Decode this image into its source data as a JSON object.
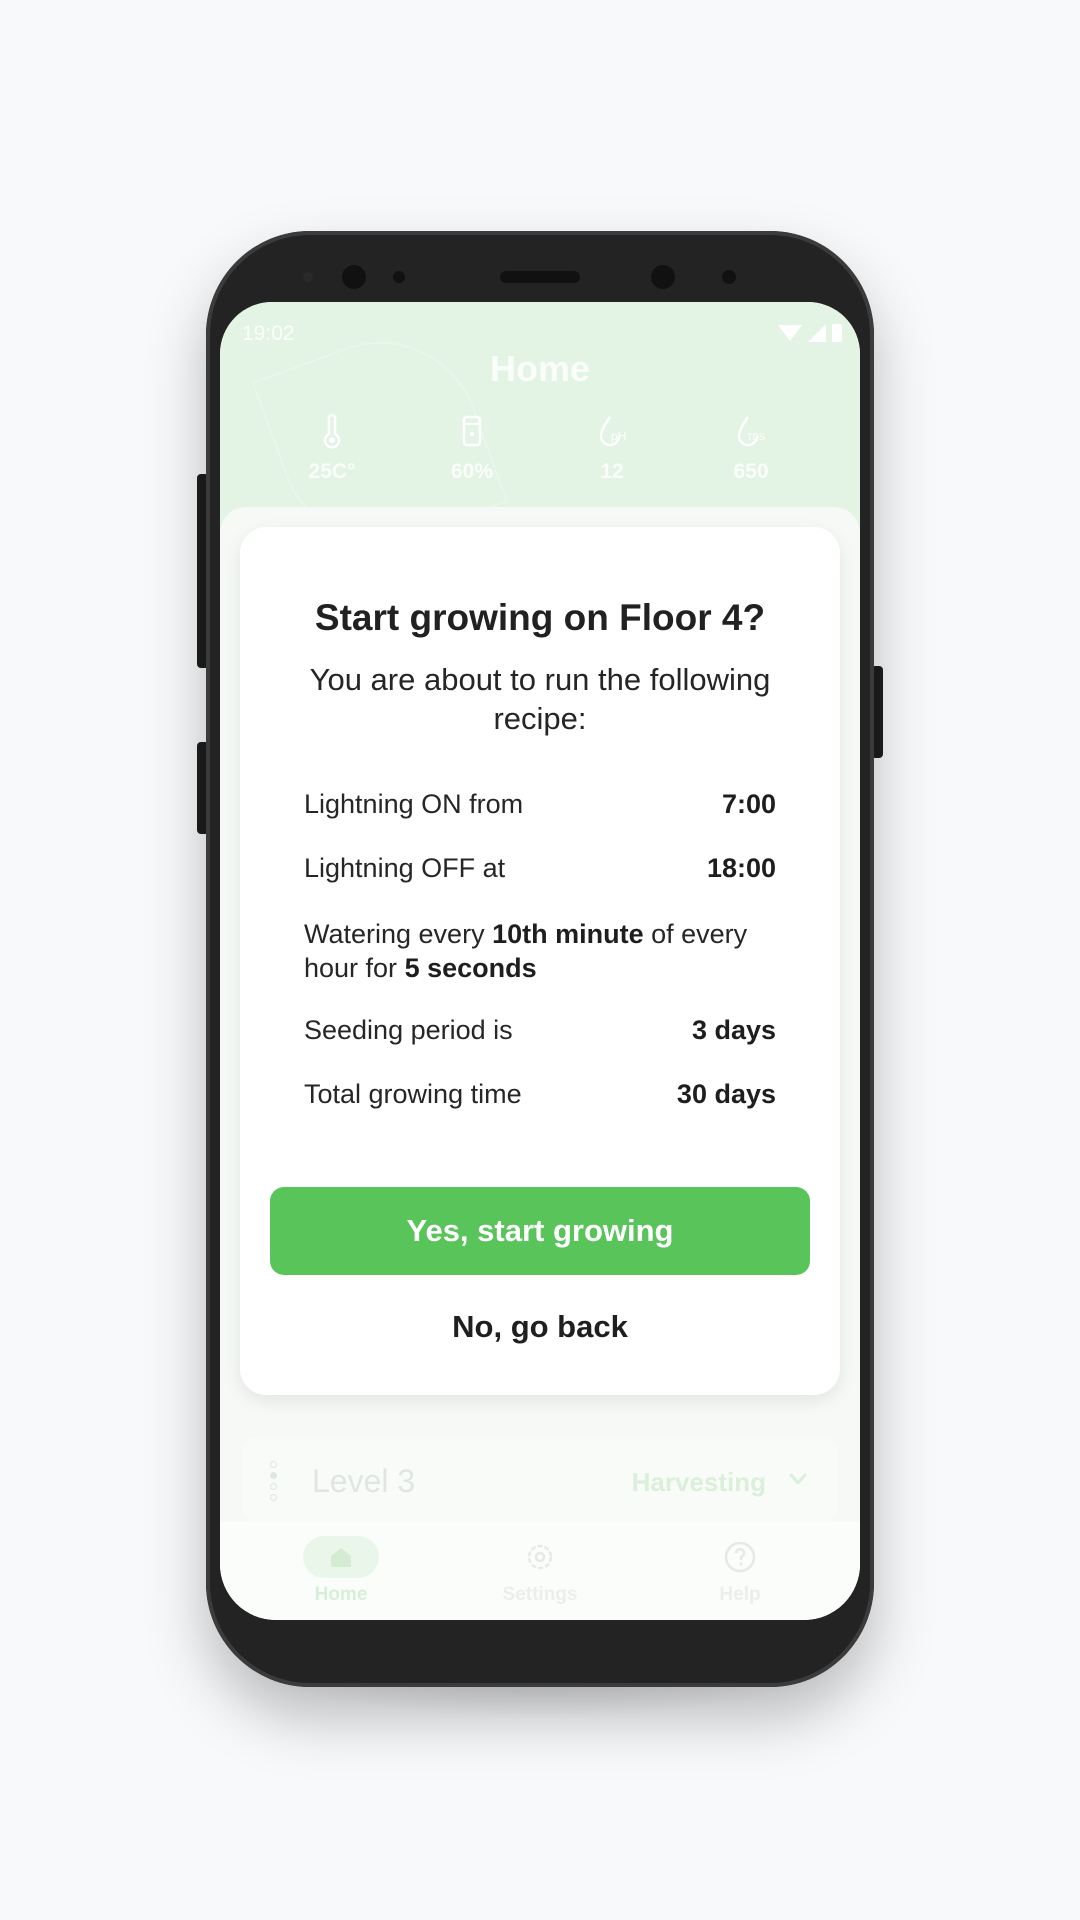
{
  "status_bar": {
    "time": "19:02"
  },
  "header": {
    "title": "Home",
    "metrics": [
      {
        "icon": "thermometer-icon",
        "value": "25C°"
      },
      {
        "icon": "water-tank-icon",
        "value": "60%"
      },
      {
        "icon": "ph-drop-icon",
        "value": "12",
        "icon_text": "pH"
      },
      {
        "icon": "tds-drop-icon",
        "value": "650",
        "icon_text": "TDS"
      }
    ]
  },
  "dialog": {
    "title": "Start growing on Floor 4?",
    "subtitle": "You are about to run the following recipe:",
    "rows": [
      {
        "label": "Lightning ON from",
        "value": "7:00"
      },
      {
        "label": "Lightning OFF at",
        "value": "18:00"
      },
      {
        "label": "Seeding period is",
        "value": "3 days"
      },
      {
        "label": "Total growing time",
        "value": "30 days"
      }
    ],
    "watering": {
      "part1": "Watering every ",
      "bold1": "10th minute",
      "part2": " of every hour for ",
      "bold2": "5 seconds"
    },
    "confirm_label": "Yes, start growing",
    "cancel_label": "No, go back"
  },
  "level_card": {
    "name": "Level 3",
    "status": "Harvesting"
  },
  "tabbar": {
    "items": [
      {
        "label": "Home",
        "icon": "home-icon"
      },
      {
        "label": "Settings",
        "icon": "gear-icon"
      },
      {
        "label": "Help",
        "icon": "help-icon"
      }
    ]
  },
  "colors": {
    "accent": "#58c45a",
    "header_bg": "#e3f3e4",
    "text": "#212121"
  }
}
